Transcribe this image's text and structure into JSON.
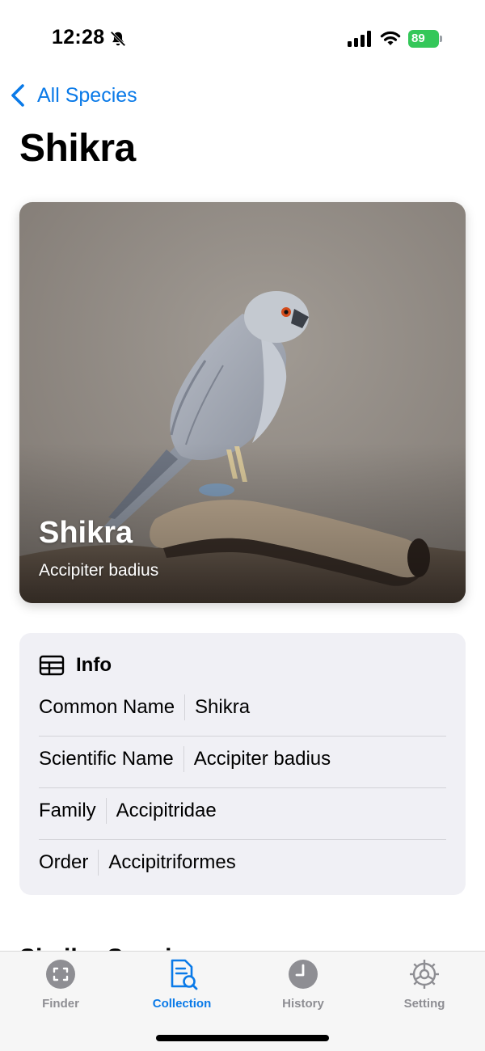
{
  "status_bar": {
    "time": "12:28",
    "battery": "89",
    "icons": [
      "bell-slash-icon",
      "signal-icon",
      "wifi-icon",
      "battery-charging-icon"
    ]
  },
  "nav": {
    "back_label": "All Species",
    "back_icon": "chevron-left-icon"
  },
  "page_title": "Shikra",
  "hero": {
    "title": "Shikra",
    "subtitle": "Accipiter badius"
  },
  "info": {
    "heading": "Info",
    "icon": "table-icon",
    "rows": [
      {
        "label": "Common Name",
        "value": "Shikra"
      },
      {
        "label": "Scientific Name",
        "value": "Accipiter badius"
      },
      {
        "label": "Family",
        "value": "Accipitridae"
      },
      {
        "label": "Order",
        "value": "Accipitriformes"
      }
    ]
  },
  "partial_section_heading": "Similar Species",
  "tab_bar": {
    "active": "Collection",
    "tabs": [
      {
        "label": "Finder",
        "icon": "viewfinder-icon"
      },
      {
        "label": "Collection",
        "icon": "document-search-icon"
      },
      {
        "label": "History",
        "icon": "clock-icon"
      },
      {
        "label": "Setting",
        "icon": "gear-icon"
      }
    ]
  },
  "colors": {
    "accent": "#0a7ae8",
    "inactive": "#8e8e93",
    "card_background": "#f0f0f5",
    "battery": "#34c759"
  }
}
